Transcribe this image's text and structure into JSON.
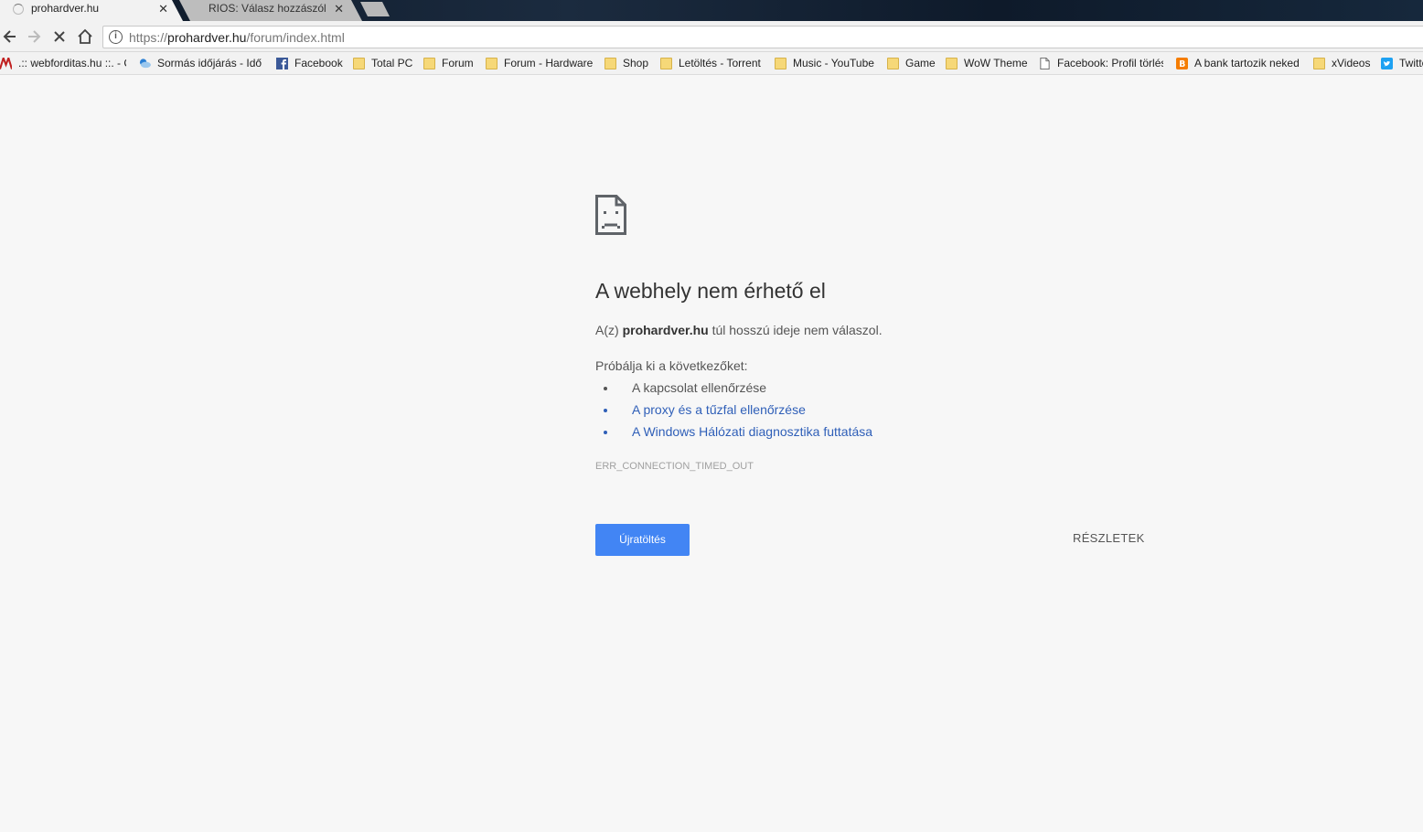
{
  "tabs": [
    {
      "title": "prohardver.hu",
      "active": true,
      "loading": true
    },
    {
      "title": "RIOS: Válasz hozzászólás",
      "active": false
    }
  ],
  "toolbar": {
    "url_scheme": "https://",
    "url_host": "prohardver.hu",
    "url_path": "/forum/index.html"
  },
  "bookmarks": [
    {
      "label": ".:: webforditas.hu ::. - C",
      "icon": "webforditas-icon"
    },
    {
      "label": "Sormás időjárás - Idő",
      "icon": "weather-icon"
    },
    {
      "label": "Facebook",
      "icon": "facebook-icon"
    },
    {
      "label": "Total PC",
      "icon": "folder-icon"
    },
    {
      "label": "Forum",
      "icon": "folder-icon"
    },
    {
      "label": "Forum - Hardware",
      "icon": "folder-icon"
    },
    {
      "label": "Shop",
      "icon": "folder-icon"
    },
    {
      "label": "Letöltés - Torrent",
      "icon": "folder-icon"
    },
    {
      "label": "Music - YouTube",
      "icon": "folder-icon"
    },
    {
      "label": "Game",
      "icon": "folder-icon"
    },
    {
      "label": "WoW Theme",
      "icon": "folder-icon"
    },
    {
      "label": "Facebook: Profil törlés",
      "icon": "page-icon"
    },
    {
      "label": "A bank tartozik neked",
      "icon": "blogger-icon"
    },
    {
      "label": "xVideos",
      "icon": "folder-icon"
    },
    {
      "label": "Twitter",
      "icon": "twitter-icon"
    }
  ],
  "error": {
    "title": "A webhely nem érhető el",
    "desc_prefix": "A(z)",
    "host": "prohardver.hu",
    "desc_suffix": "túl hosszú ideje nem válaszol.",
    "try_label": "Próbálja ki a következőket:",
    "suggestions": [
      "A kapcsolat ellenőrzése",
      "A proxy és a tűzfal ellenőrzése",
      "A Windows Hálózati diagnosztika futtatása"
    ],
    "code": "ERR_CONNECTION_TIMED_OUT",
    "reload_label": "Újratöltés",
    "details_label": "RÉSZLETEK"
  },
  "colors": {
    "accent": "#4285f4",
    "link": "#2f5fb8",
    "background": "#f7f7f7"
  }
}
